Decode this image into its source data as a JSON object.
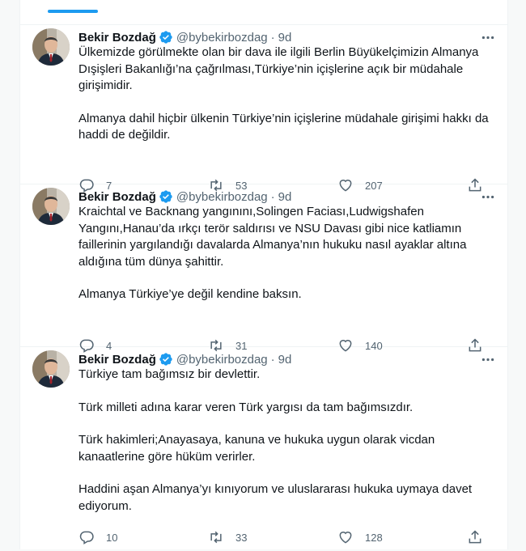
{
  "colors": {
    "accent": "#1d9bf0",
    "muted": "#536471",
    "text": "#0f1419",
    "divider": "#eff3f4"
  },
  "tweets": [
    {
      "author": "Bekir Bozdağ",
      "handle": "@bybekirbozdag",
      "separator": "·",
      "time": "9d",
      "verified_icon": "verified-badge-icon",
      "paragraphs": [
        "Ülkemizde görülmekte olan bir dava ile ilgili Berlin Büyükelçimizin Almanya Dışişleri Bakanlığı’na çağrılması,Türkiye’nin içişlerine açık bir müdahale girişimidir.",
        "Almanya dahil hiçbir ülkenin Türkiye’nin içişlerine müdahale girişimi hakkı da haddi de değildir."
      ],
      "replies": "7",
      "retweets": "53",
      "likes": "207"
    },
    {
      "author": "Bekir Bozdağ",
      "handle": "@bybekirbozdag",
      "separator": "·",
      "time": "9d",
      "verified_icon": "verified-badge-icon",
      "paragraphs": [
        "Kraichtal ve Backnang yangınını,Solingen Faciası,Ludwigshafen Yangını,Hanau’da ırkçı terör saldırısı ve NSU Davası gibi nice katliamın faillerinin yargılandığı davalarda Almanya’nın hukuku nasıl ayaklar altına aldığına tüm dünya şahittir.",
        "Almanya Türkiye’ye değil kendine baksın."
      ],
      "replies": "4",
      "retweets": "31",
      "likes": "140"
    },
    {
      "author": "Bekir Bozdağ",
      "handle": "@bybekirbozdag",
      "separator": "·",
      "time": "9d",
      "verified_icon": "verified-badge-icon",
      "paragraphs": [
        "Türkiye tam bağımsız bir devlettir.",
        "Türk milleti adına karar veren Türk yargısı da tam bağımsızdır.",
        "Türk hakimleri;Anayasaya, kanuna ve hukuka uygun olarak vicdan kanaatlerine göre hüküm verirler.",
        "Haddini aşan Almanya’yı kınıyorum ve uluslararası hukuka uymaya davet ediyorum."
      ],
      "replies": "10",
      "retweets": "33",
      "likes": "128"
    }
  ]
}
